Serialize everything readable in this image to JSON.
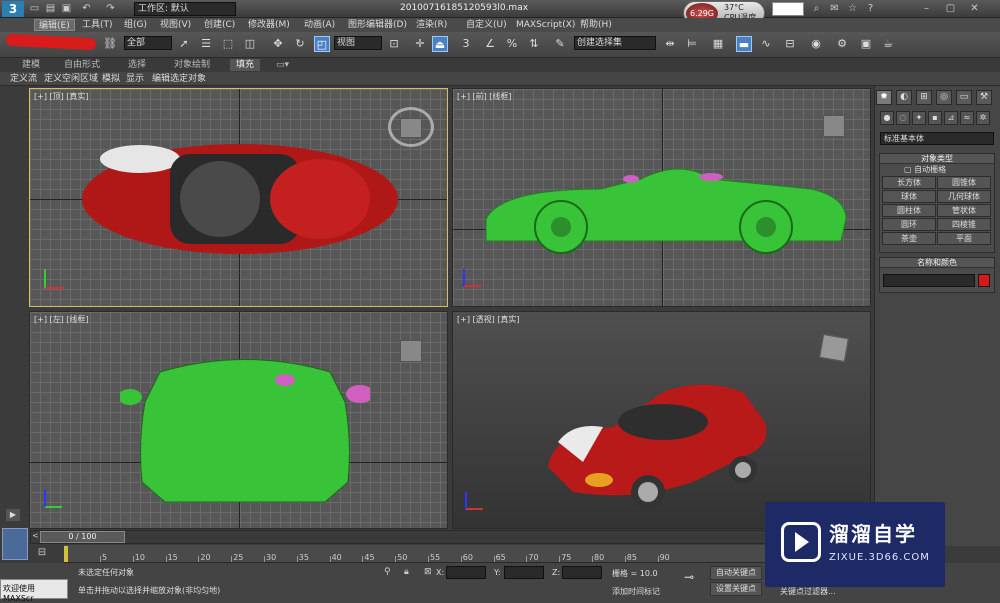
{
  "title": {
    "filename": "20100716185120593l0.max",
    "workspace": "工作区: 默认"
  },
  "cpu": {
    "value": "6.29G",
    "temp": "37°C",
    "label": "CPU温度"
  },
  "menu": [
    "编辑(E)",
    "工具(T)",
    "组(G)",
    "视图(V)",
    "创建(C)",
    "修改器(M)",
    "动画(A)",
    "图形编辑器(D)",
    "渲染(R)",
    "自定义(U)",
    "MAXScript(X)",
    "帮助(H)"
  ],
  "toolbar": {
    "filter": "全部",
    "refcoord": "视图",
    "selset": "创建选择集"
  },
  "ribbon_tabs": [
    "建模",
    "自由形式",
    "选择",
    "对象绘制",
    "填充"
  ],
  "ribbon_sub": [
    "定义流",
    "定义空闲区域",
    "模拟",
    "显示",
    "编辑选定对象"
  ],
  "viewports": {
    "top": "[+] [顶] [真实]",
    "front": "[+] [前] [线框]",
    "left": "[+] [左] [线框]",
    "persp": "[+] [透视] [真实]"
  },
  "cmdpanel": {
    "dropdown": "标准基本体",
    "obj_type_title": "对象类型",
    "autogrid": "自动栅格",
    "buttons": [
      "长方体",
      "圆锥体",
      "球体",
      "几何球体",
      "圆柱体",
      "管状体",
      "圆环",
      "四棱锥",
      "茶壶",
      "平面"
    ],
    "name_color_title": "名称和颜色",
    "object_color": "#d81818"
  },
  "timeline": {
    "frame": "0 / 100",
    "ticks": [
      "5",
      "10",
      "15",
      "20",
      "25",
      "30",
      "35",
      "40",
      "45",
      "50",
      "55",
      "60",
      "65",
      "70",
      "75",
      "80",
      "85",
      "90"
    ]
  },
  "status": {
    "welcome": "欢迎使用 MAXScr",
    "line1": "未选定任何对象",
    "line2": "单击并拖动以选择并缩放对象(非均匀地)",
    "x": "X:",
    "y": "Y:",
    "z": "Z:",
    "grid": "栅格 = 10.0",
    "autokey": "自动关键点",
    "setkey": "设置关键点",
    "addtime": "添加时间标记",
    "keyfilter": "关键点过滤器..."
  },
  "watermark": {
    "title": "溜溜自学",
    "sub": "ZIXUE.3D66.COM"
  }
}
